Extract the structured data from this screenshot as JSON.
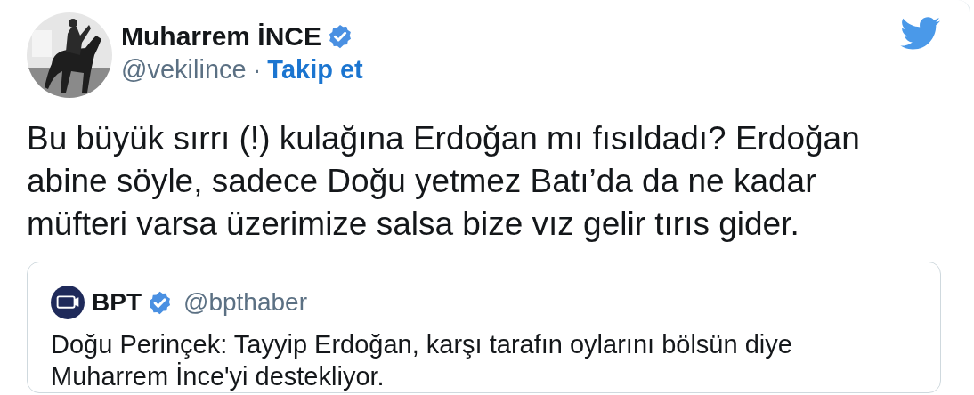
{
  "author": {
    "name": "Muharrem İNCE",
    "verified": true,
    "handle": "@vekilince",
    "separator": "·",
    "follow": "Takip et"
  },
  "text": "Bu büyük sırrı (!) kulağına Erdoğan mı fısıldadı? Erdoğan abine söyle, sadece Doğu yetmez Batı’da da ne kadar müfteri varsa üzerimize salsa bize vız gelir tırıs gider.",
  "quoted": {
    "name": "BPT",
    "verified": true,
    "handle": "@bpthaber",
    "text": "Doğu Perinçek: Tayyip Erdoğan, karşı tarafın oylarını bölsün diye Muharrem İnce'yi destekliyor."
  }
}
